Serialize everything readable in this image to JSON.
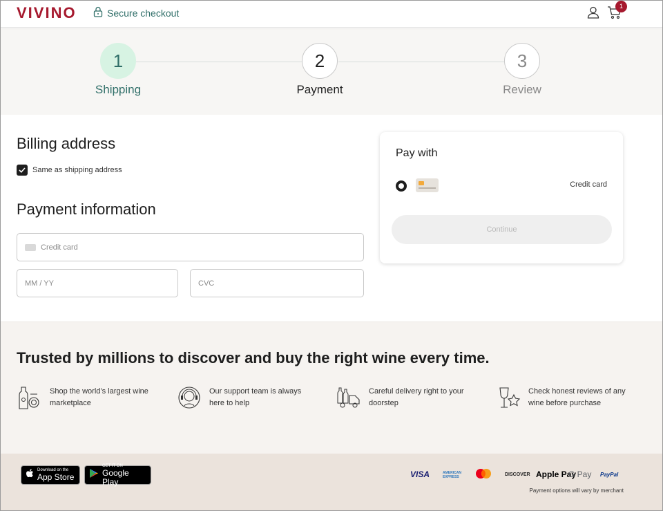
{
  "header": {
    "logo": "VIVINO",
    "secure_label": "Secure checkout",
    "cart_count": "1",
    "colors": {
      "brand": "#a6192e",
      "accent": "#2f6e68"
    }
  },
  "steps": [
    {
      "number": "1",
      "label": "Shipping",
      "state": "complete"
    },
    {
      "number": "2",
      "label": "Payment",
      "state": "current"
    },
    {
      "number": "3",
      "label": "Review",
      "state": "upcoming"
    }
  ],
  "billing": {
    "title": "Billing address",
    "same_as_shipping_label": "Same as shipping address",
    "same_as_shipping_checked": true
  },
  "payment": {
    "title": "Payment information",
    "card_number_placeholder": "Credit card",
    "expiry_placeholder": "MM / YY",
    "cvc_placeholder": "CVC"
  },
  "pay_with": {
    "title": "Pay with",
    "method_label": "Credit card",
    "continue_label": "Continue"
  },
  "trust": {
    "title": "Trusted by millions to discover and buy the right wine every time.",
    "features": [
      {
        "icon": "wine-bottles-icon",
        "text": "Shop the world’s largest wine marketplace"
      },
      {
        "icon": "support-agent-icon",
        "text": "Our support team is always here to help"
      },
      {
        "icon": "delivery-truck-icon",
        "text": "Careful delivery right to your doorstep"
      },
      {
        "icon": "wine-glass-star-icon",
        "text": "Check honest reviews of any wine before purchase"
      }
    ]
  },
  "footer": {
    "app_store_small": "Download on the",
    "app_store_big": "App Store",
    "google_play_small": "GET IT ON",
    "google_play_big": "Google Play",
    "payment_logos": [
      "VISA",
      "AMERICAN EXPRESS",
      "mastercard",
      "DISCOVER",
      "Apple Pay",
      "G Pay",
      "PayPal"
    ],
    "payment_note": "Payment options will vary by merchant"
  }
}
